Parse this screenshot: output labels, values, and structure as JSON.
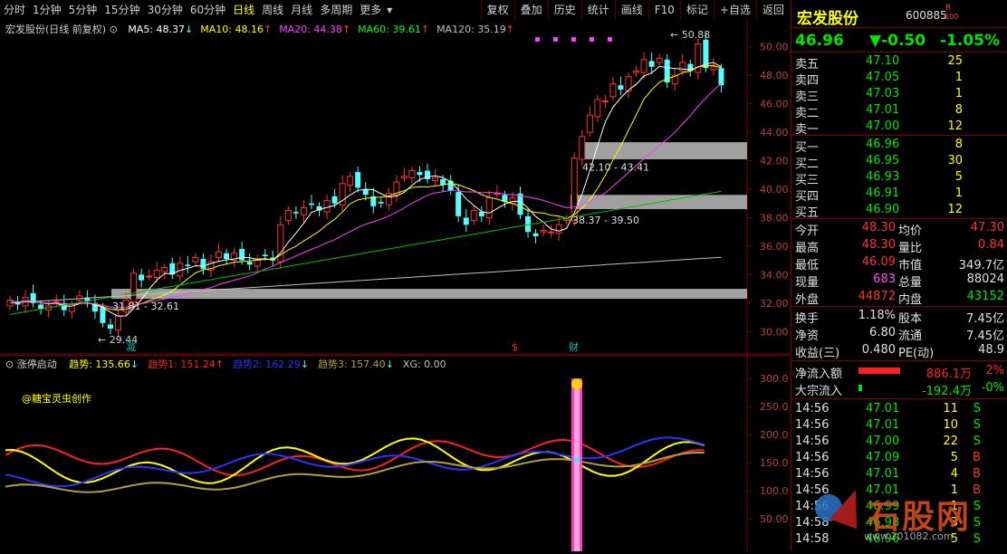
{
  "toolbar": {
    "periods": [
      "分时",
      "1分钟",
      "5分钟",
      "15分钟",
      "30分钟",
      "60分钟",
      "日线",
      "周线",
      "月线",
      "多周期",
      "更多"
    ],
    "active_period": "日线",
    "more_arrow": "▾",
    "buttons": [
      "复权",
      "叠加",
      "历史",
      "统计",
      "画线",
      "F10",
      "标记",
      "+自选",
      "返回"
    ]
  },
  "kline": {
    "title": "宏发股份(日线 前复权)",
    "ma": [
      {
        "label": "MA5: 48.37",
        "arrow": "↓",
        "color": "#ffffff"
      },
      {
        "label": "MA10: 48.16",
        "arrow": "↑",
        "color": "#ffff00"
      },
      {
        "label": "MA20: 44.38",
        "arrow": "↑",
        "color": "#ff40ff"
      },
      {
        "label": "MA60: 39.61",
        "arrow": "↑",
        "color": "#00ff00"
      },
      {
        "label": "MA120: 35.19",
        "arrow": "↑",
        "color": "#c0c0c0"
      }
    ],
    "y_ticks": [
      "50.00",
      "48.00",
      "46.00",
      "44.00",
      "42.00",
      "40.00",
      "38.00",
      "36.00",
      "34.00",
      "32.00",
      "30.00"
    ],
    "annotations": {
      "high": "50.88",
      "low": "29.44",
      "zone1": "31.81 - 32.61",
      "zone2": "38.37 - 39.50",
      "zone3": "42.10 - 43.41"
    },
    "markers": {
      "jian": "减",
      "s": "$",
      "cai": "财"
    }
  },
  "indicator": {
    "name": "涨停启动",
    "lines": [
      {
        "label": "趋势: 135.66",
        "arrow": "↓",
        "color": "#ffff00"
      },
      {
        "label": "趋势1: 151.24",
        "arrow": "↑",
        "color": "#ff2020"
      },
      {
        "label": "趋势2: 162.29",
        "arrow": "↓",
        "color": "#3030ff"
      },
      {
        "label": "趋势3: 157.40",
        "arrow": "↓",
        "color": "#b0a040"
      },
      {
        "label": "XG: 0.00",
        "arrow": "",
        "color": "#c0c0c0"
      }
    ],
    "credit": "@糖宝灵虫创作",
    "y_ticks": [
      "300.0",
      "250.0",
      "200.0",
      "150.0",
      "100.0",
      "50.00"
    ]
  },
  "quote": {
    "name": "宏发股份",
    "code": "600885",
    "badge_r": "R",
    "badge_n": "500",
    "price": "46.96",
    "change": "▼-0.50",
    "pct": "-1.05%",
    "asks": [
      {
        "label": "卖五",
        "price": "47.10",
        "vol": "25"
      },
      {
        "label": "卖四",
        "price": "47.05",
        "vol": "1"
      },
      {
        "label": "卖三",
        "price": "47.03",
        "vol": "1"
      },
      {
        "label": "卖二",
        "price": "47.01",
        "vol": "8"
      },
      {
        "label": "卖一",
        "price": "47.00",
        "vol": "12"
      }
    ],
    "bids": [
      {
        "label": "买一",
        "price": "46.96",
        "vol": "8"
      },
      {
        "label": "买二",
        "price": "46.95",
        "vol": "30"
      },
      {
        "label": "买三",
        "price": "46.93",
        "vol": "5"
      },
      {
        "label": "买四",
        "price": "46.91",
        "vol": "1"
      },
      {
        "label": "买五",
        "price": "46.90",
        "vol": "12"
      }
    ],
    "stats": [
      {
        "l1": "今开",
        "v1": "48.30",
        "c1": "red",
        "l2": "均价",
        "v2": "47.30",
        "c2": "red"
      },
      {
        "l1": "最高",
        "v1": "48.30",
        "c1": "red",
        "l2": "量比",
        "v2": "0.84",
        "c2": "red"
      },
      {
        "l1": "最低",
        "v1": "46.09",
        "c1": "red",
        "l2": "市值",
        "v2": "349.7亿",
        "c2": "wht"
      },
      {
        "l1": "现量",
        "v1": "683",
        "c1": "mag",
        "l2": "总量",
        "v2": "88024",
        "c2": "wht"
      },
      {
        "l1": "外盘",
        "v1": "44872",
        "c1": "red",
        "l2": "内盘",
        "v2": "43152",
        "c2": "grn"
      }
    ],
    "finance": [
      {
        "l1": "换手",
        "v1": "1.18%",
        "l2": "股本",
        "v2": "7.45亿"
      },
      {
        "l1": "净资",
        "v1": "6.80",
        "l2": "流通",
        "v2": "7.45亿"
      },
      {
        "l1": "收益(三)",
        "v1": "0.480",
        "l2": "PE(动)",
        "v2": "48.9"
      }
    ],
    "flow": [
      {
        "label": "净流入额",
        "value": "886.1万",
        "pct": "2%",
        "color": "#ff2020",
        "bar": 0.85
      },
      {
        "label": "大宗流入",
        "value": "-192.4万",
        "pct": "-0%",
        "color": "#00e600",
        "bar": 0.08
      }
    ],
    "ticks": [
      {
        "time": "14:56",
        "price": "47.01",
        "vol": "11",
        "side": "S"
      },
      {
        "time": "14:56",
        "price": "47.01",
        "vol": "10",
        "side": "S"
      },
      {
        "time": "14:56",
        "price": "47.00",
        "vol": "22",
        "side": "S"
      },
      {
        "time": "14:56",
        "price": "47.09",
        "vol": "5",
        "side": "B"
      },
      {
        "time": "14:56",
        "price": "47.01",
        "vol": "4",
        "side": "B"
      },
      {
        "time": "14:56",
        "price": "47.01",
        "vol": "1",
        "side": "B"
      },
      {
        "time": "14:56",
        "price": "46.99",
        "vol": "1",
        "side": "S"
      },
      {
        "time": "14:58",
        "price": "46.98",
        "vol": "3",
        "side": "S"
      },
      {
        "time": "14:58",
        "price": "46.96",
        "vol": "5",
        "side": "S"
      }
    ]
  },
  "watermark": {
    "text": "石股网",
    "url": "www.201082.com"
  },
  "colors": {
    "up": "#ff3232",
    "down": "#54ffff",
    "frame": "#800000",
    "bg": "#000000"
  }
}
